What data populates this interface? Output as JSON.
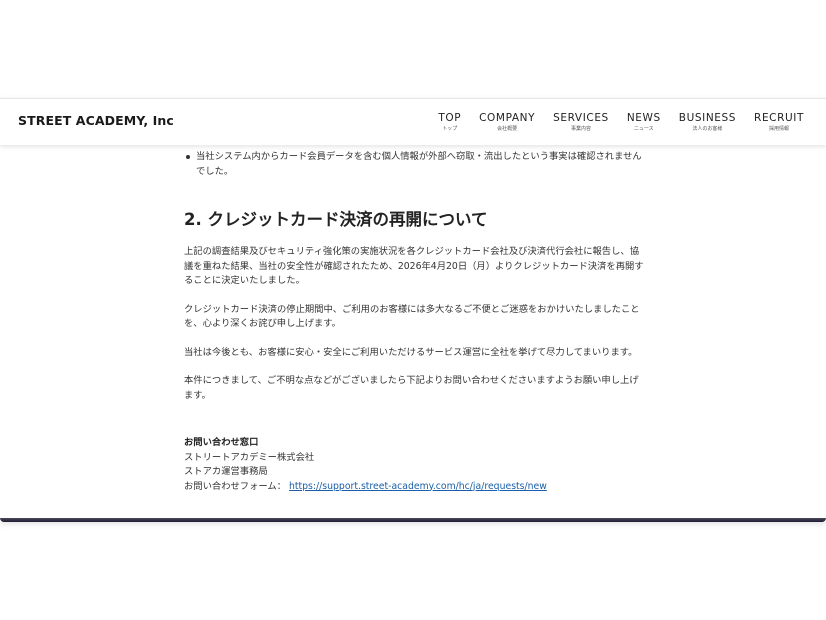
{
  "header": {
    "logo": "STREET ACADEMY, Inc",
    "nav": [
      {
        "label": "TOP",
        "sub": "トップ"
      },
      {
        "label": "COMPANY",
        "sub": "会社概要"
      },
      {
        "label": "SERVICES",
        "sub": "事業内容"
      },
      {
        "label": "NEWS",
        "sub": "ニュース"
      },
      {
        "label": "BUSINESS",
        "sub": "法人のお客様"
      },
      {
        "label": "RECRUIT",
        "sub": "採用情報"
      }
    ]
  },
  "article": {
    "bullet": "当社システム内からカード会員データを含む個人情報が外部へ窃取・流出したという事実は確認されませんでした。",
    "section_title": "2. クレジットカード決済の再開について",
    "paragraphs": [
      "上記の調査結果及びセキュリティ強化策の実施状況を各クレジットカード会社及び決済代行会社に報告し、協議を重ねた結果、当社の安全性が確認されたため、2026年4月20日（月）よりクレジットカード決済を再開することに決定いたしました。",
      "クレジットカード決済の停止期間中、ご利用のお客様には多大なるご不便とご迷惑をおかけいたしましたことを、心より深くお詫び申し上げます。",
      "当社は今後とも、お客様に安心・安全にご利用いただけるサービス運営に全社を挙げて尽力してまいります。",
      "本件につきまして、ご不明な点などがございましたら下記よりお問い合わせくださいますようお願い申し上げます。"
    ],
    "contact": {
      "title": "お問い合わせ窓口",
      "company": "ストリートアカデミー株式会社",
      "office": "ストアカ運営事務局",
      "form_label": "お問い合わせフォーム：",
      "form_url": "https://support.street-academy.com/hc/ja/requests/new"
    }
  }
}
